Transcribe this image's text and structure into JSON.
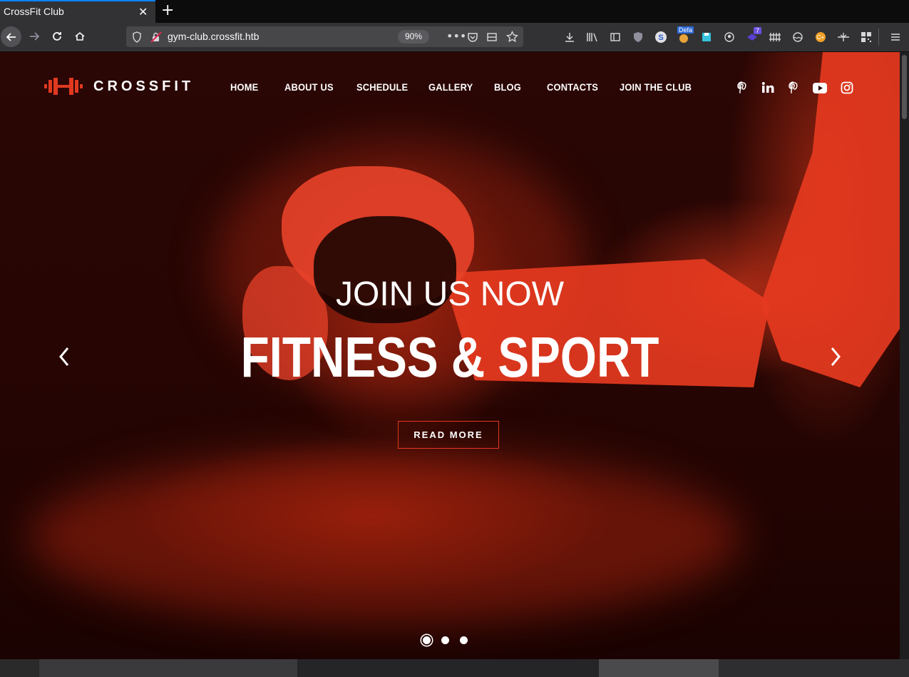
{
  "browser": {
    "tab_title": "CrossFit Club",
    "tab_close": "✕",
    "new_tab": "+",
    "url": "gym-club.crossfit.htb",
    "zoom": "90%",
    "ext_badge_defa": "Defa",
    "ext_badge_count": "7"
  },
  "site": {
    "logo_text": "CROSSFIT",
    "menu": [
      "HOME",
      "ABOUT US",
      "SCHEDULE",
      "GALLERY",
      "BLOG",
      "CONTACTS",
      "JOIN THE CLUB"
    ],
    "social_icons": [
      "pinterest-icon",
      "linkedin-icon",
      "pinterest-icon",
      "youtube-icon",
      "instagram-icon"
    ],
    "accent_color": "#e0391f"
  },
  "hero": {
    "subtitle": "JOIN US NOW",
    "title": "FITNESS & SPORT",
    "button": "READ MORE",
    "slide_count": 3,
    "active_slide": 1
  }
}
